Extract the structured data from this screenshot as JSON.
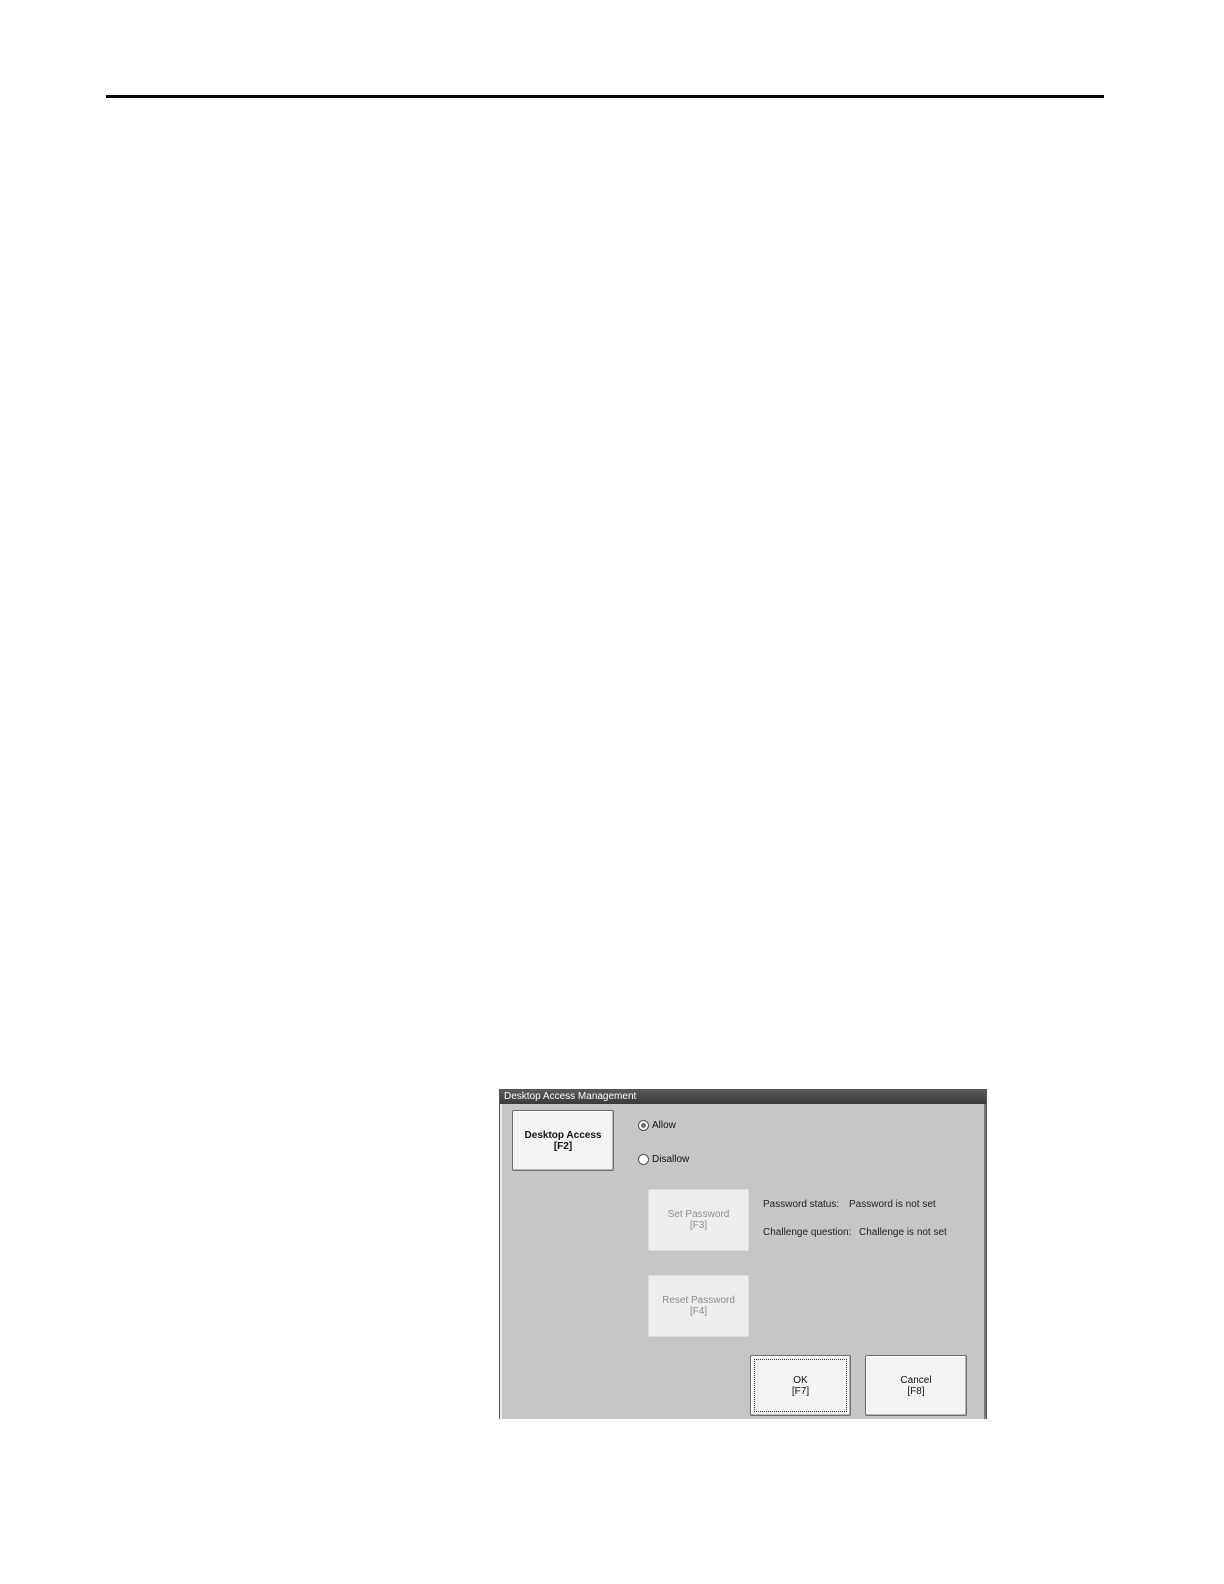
{
  "dialog": {
    "title": "Desktop Access Management",
    "desktop_access": {
      "label": "Desktop Access",
      "key": "[F2]"
    },
    "options": [
      {
        "label": "Allow",
        "selected": true
      },
      {
        "label": "Disallow",
        "selected": false
      }
    ],
    "set_password": {
      "label": "Set Password",
      "key": "[F3]",
      "enabled": false
    },
    "reset_password": {
      "label": "Reset Password",
      "key": "[F4]",
      "enabled": false
    },
    "status": {
      "password_label": "Password status:",
      "password_value": "Password is not set",
      "challenge_label": "Challenge question:",
      "challenge_value": "Challenge is not set"
    },
    "ok": {
      "label": "OK",
      "key": "[F7]"
    },
    "cancel": {
      "label": "Cancel",
      "key": "[F8]"
    }
  }
}
